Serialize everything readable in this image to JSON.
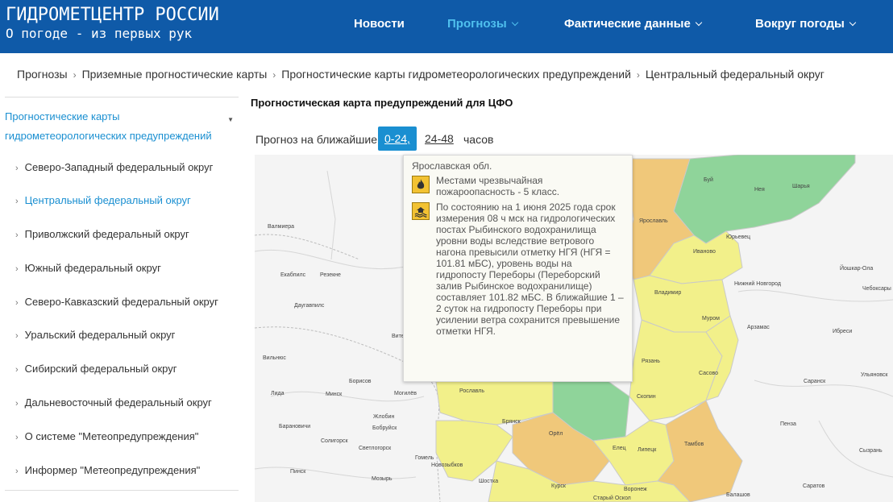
{
  "header": {
    "brand_title": "ГИДРОМЕТЦЕНТР РОССИИ",
    "brand_subtitle": "О погоде - из первых рук",
    "nav": [
      {
        "label": "Новости",
        "has_dropdown": false,
        "active": false
      },
      {
        "label": "Прогнозы",
        "has_dropdown": true,
        "active": true
      },
      {
        "label": "Фактические данные",
        "has_dropdown": true,
        "active": false
      },
      {
        "label": "Вокруг погоды",
        "has_dropdown": true,
        "active": false
      }
    ],
    "bg_color": "#0f5aa8",
    "active_color": "#4fc0ee"
  },
  "breadcrumb": [
    "Прогнозы",
    "Приземные прогностические карты",
    "Прогностические карты гидрометеорологических предупреждений",
    "Центральный федеральный округ"
  ],
  "sidebar": {
    "section_title": "Прогностические карты гидрометеорологических предупреждений",
    "items": [
      {
        "label": "Северо-Западный федеральный округ",
        "active": false
      },
      {
        "label": "Центральный федеральный округ",
        "active": true
      },
      {
        "label": "Приволжский федеральный округ",
        "active": false
      },
      {
        "label": "Южный федеральный округ",
        "active": false
      },
      {
        "label": "Северо-Кавказский федеральный округ",
        "active": false
      },
      {
        "label": "Уральский федеральный округ",
        "active": false
      },
      {
        "label": "Сибирский федеральный округ",
        "active": false
      },
      {
        "label": "Дальневосточный федеральный округ",
        "active": false
      },
      {
        "label": "О системе \"Метеопредупреждения\"",
        "active": false
      },
      {
        "label": "Информер \"Метеопредупреждения\"",
        "active": false
      }
    ],
    "link_color": "#1a8fd1"
  },
  "main": {
    "title": "Прогностическая карта предупреждений для ЦФО",
    "range_label": "Прогноз на ближайшие",
    "range_options": [
      "0-24,",
      "24-48"
    ],
    "range_unit": "часов",
    "active_range": "0-24,"
  },
  "map": {
    "colors": {
      "yellow": "#f2f08a",
      "orange": "#f0c87a",
      "green": "#8fd49a",
      "land": "#f4f4f4"
    },
    "cities": [
      {
        "name": "Буй"
      },
      {
        "name": "Нея"
      },
      {
        "name": "Шарья"
      },
      {
        "name": "Ярославль"
      },
      {
        "name": "Юрьевец"
      },
      {
        "name": "Иваново"
      },
      {
        "name": "Нижний Новгород"
      },
      {
        "name": "Йошкар-Ола"
      },
      {
        "name": "Чебоксары"
      },
      {
        "name": "Владимир"
      },
      {
        "name": "Муром"
      },
      {
        "name": "Арзамас"
      },
      {
        "name": "Рязань"
      },
      {
        "name": "Сасово"
      },
      {
        "name": "Ибреси"
      },
      {
        "name": "Саранск"
      },
      {
        "name": "Ульяновск"
      },
      {
        "name": "Скопин"
      },
      {
        "name": "Пенза"
      },
      {
        "name": "Тамбов"
      },
      {
        "name": "Орёл"
      },
      {
        "name": "Брянск"
      },
      {
        "name": "Рославль"
      },
      {
        "name": "Елец"
      },
      {
        "name": "Липецк"
      },
      {
        "name": "Курск"
      },
      {
        "name": "Воронеж"
      },
      {
        "name": "Балашов"
      },
      {
        "name": "Саратов"
      },
      {
        "name": "Сызрань"
      },
      {
        "name": "Витебск"
      },
      {
        "name": "Борисов"
      },
      {
        "name": "Минск"
      },
      {
        "name": "Могилёв"
      },
      {
        "name": "Бобруйск"
      },
      {
        "name": "Гомель"
      },
      {
        "name": "Пинск"
      },
      {
        "name": "Мозырь"
      },
      {
        "name": "Светлогорск"
      },
      {
        "name": "Барановичи"
      },
      {
        "name": "Солигорск"
      },
      {
        "name": "Шостка"
      },
      {
        "name": "Лида"
      },
      {
        "name": "Вильнюс"
      },
      {
        "name": "Даугавпилс"
      },
      {
        "name": "Екабпилс"
      },
      {
        "name": "Резекне"
      },
      {
        "name": "Валмиера"
      },
      {
        "name": "Новозыбков"
      },
      {
        "name": "Старый Оскол"
      },
      {
        "name": "Жлобин"
      }
    ]
  },
  "tooltip": {
    "region": "Ярославская обл.",
    "warnings": [
      {
        "icon": "fire-danger-icon",
        "text": "Местами чрезвычайная пожароопасность - 5 класс."
      },
      {
        "icon": "flood-icon",
        "text": "По состоянию на 1 июня 2025 года срок измерения 08 ч мск на гидрологических постах Рыбинского водохранилища уровни воды вследствие ветрового нагона превысили отметку НГЯ (НГЯ = 101.81 мБС), уровень воды на гидропосту Переборы (Переборский залив Рыбинское водохранилище) составляет 101.82 мБС. В ближайшие 1 – 2 суток на гидропосту Переборы при усилении ветра сохранится превышение отметки НГЯ."
      }
    ],
    "icon_color": "#f2c232"
  }
}
